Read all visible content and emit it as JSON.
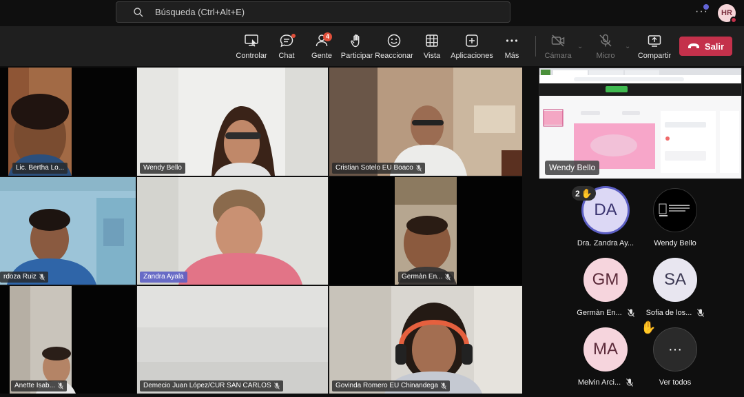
{
  "search": {
    "placeholder": "Búsqueda (Ctrl+Alt+E)"
  },
  "user": {
    "initials": "HR"
  },
  "toolbar": {
    "control": "Controlar",
    "chat": "Chat",
    "people": "Gente",
    "people_count": "4",
    "raise": "Participar",
    "react": "Reaccionar",
    "view": "Vista",
    "apps": "Aplicaciones",
    "more": "Más",
    "camera": "Cámara",
    "mic": "Micro",
    "share": "Compartir",
    "leave": "Salir"
  },
  "grid": {
    "t1": "Lic. Bertha Lo...",
    "t2": "Wendy Bello",
    "t3": "Cristian Sotelo EU Boaco",
    "t4": "rdoza Ruiz",
    "t5": "Zandra Ayala",
    "t6": "Germàn En...",
    "t7": "Anette Isab...",
    "t8": "Demecio Juan López/CUR SAN CARLOS",
    "t9": "Govinda Romero EU Chinandega"
  },
  "shared": {
    "presenter": "Wendy Bello"
  },
  "participants": [
    {
      "initials": "DA",
      "name": "Dra. Zandra Ay...",
      "hand_count": "2"
    },
    {
      "initials": "",
      "name": "Wendy Bello"
    },
    {
      "initials": "GM",
      "name": "Germàn En..."
    },
    {
      "initials": "SA",
      "name": "Sofia de los..."
    },
    {
      "initials": "MA",
      "name": "Melvin Arci..."
    },
    {
      "initials": "···",
      "name": "Ver todos"
    }
  ],
  "colors": {
    "accent": "#5c5fc4",
    "leave": "#c4314b",
    "badge": "#e04f3a"
  }
}
